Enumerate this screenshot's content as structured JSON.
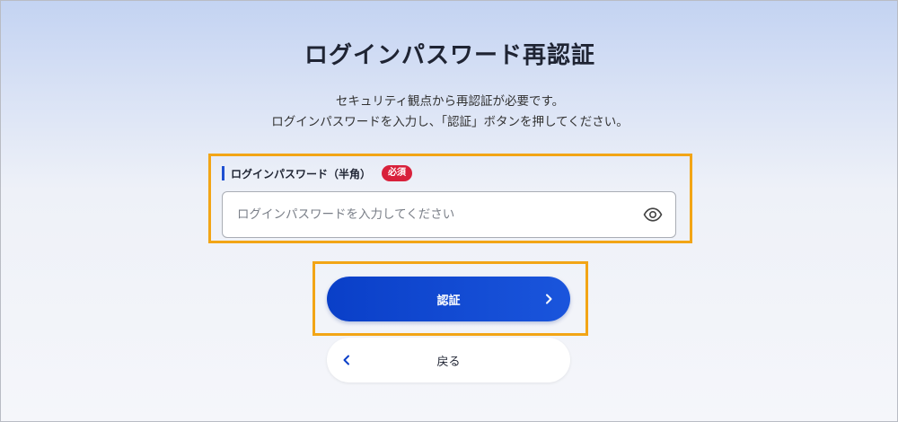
{
  "page": {
    "title": "ログインパスワード再認証",
    "description_line1": "セキュリティ観点から再認証が必要です。",
    "description_line2": "ログインパスワードを入力し、「認証」ボタンを押してください。"
  },
  "form": {
    "password_label": "ログインパスワード（半角）",
    "required_badge": "必須",
    "password_placeholder": "ログインパスワードを入力してください",
    "password_value": ""
  },
  "buttons": {
    "auth_label": "認証",
    "back_label": "戻る"
  },
  "icons": {
    "visibility_toggle": "eye-icon",
    "next": "chevron-right-icon",
    "back": "chevron-left-icon"
  },
  "colors": {
    "primary": "#0a3fc8",
    "required": "#d8213b",
    "highlight": "#f2a516",
    "label_accent": "#1f4fd1"
  }
}
